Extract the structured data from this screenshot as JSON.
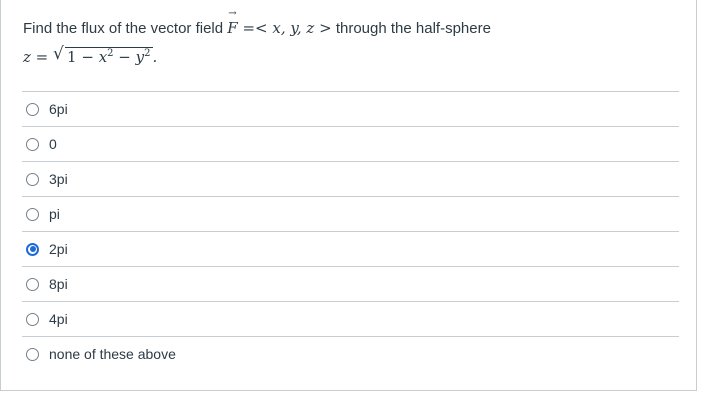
{
  "question": {
    "prefix": "Find the flux of the vector field ",
    "field_symbol": "F",
    "arrow": "→",
    "field_def": "=< x, y, z >",
    "suffix": " through the half-sphere",
    "eq_lhs": "z =",
    "radicand_1": "1 − ",
    "radicand_x": "x",
    "exp_x": "2",
    "radicand_mid": " − ",
    "radicand_y": "y",
    "exp_y": "2",
    "end": "."
  },
  "answers": [
    {
      "label": "6pi",
      "selected": false
    },
    {
      "label": "0",
      "selected": false
    },
    {
      "label": "3pi",
      "selected": false
    },
    {
      "label": "pi",
      "selected": false
    },
    {
      "label": "2pi",
      "selected": true
    },
    {
      "label": "8pi",
      "selected": false
    },
    {
      "label": "4pi",
      "selected": false
    },
    {
      "label": "none of these above",
      "selected": false
    }
  ],
  "colors": {
    "text": "#2d3b45",
    "border": "#c7cdd1",
    "selected": "#1e6bd6"
  }
}
